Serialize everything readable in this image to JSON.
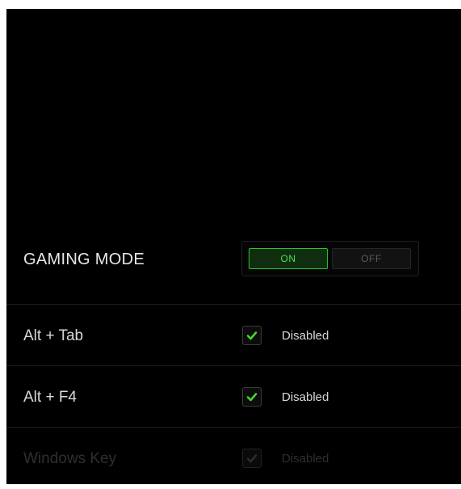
{
  "gaming_mode": {
    "label": "GAMING MODE",
    "on_label": "ON",
    "off_label": "OFF",
    "selected": "ON"
  },
  "options": [
    {
      "label": "Alt + Tab",
      "checked": true,
      "state": "Disabled",
      "enabled": true
    },
    {
      "label": "Alt + F4",
      "checked": true,
      "state": "Disabled",
      "enabled": true
    },
    {
      "label": "Windows Key",
      "checked": true,
      "state": "Disabled",
      "enabled": false
    }
  ],
  "colors": {
    "background": "#000000",
    "accent_green": "#44d62c",
    "text": "#e0e0e0",
    "disabled_text": "#2f2f2f"
  },
  "icons": {
    "checkbox": "checkmark-icon"
  }
}
